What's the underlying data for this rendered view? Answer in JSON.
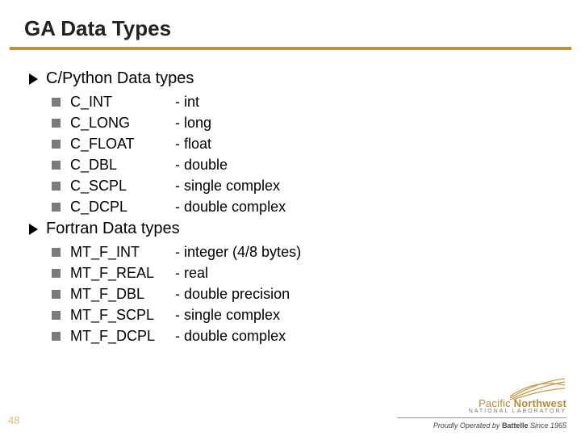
{
  "title": "GA Data Types",
  "pageNumber": "48",
  "sections": [
    {
      "heading": "C/Python Data types",
      "items": [
        {
          "name": "C_INT",
          "desc": "- int"
        },
        {
          "name": "C_LONG",
          "desc": "- long"
        },
        {
          "name": "C_FLOAT",
          "desc": "- float"
        },
        {
          "name": "C_DBL",
          "desc": "- double"
        },
        {
          "name": "C_SCPL",
          "desc": "- single complex"
        },
        {
          "name": "C_DCPL",
          "desc": "- double complex"
        }
      ]
    },
    {
      "heading": "Fortran Data types",
      "items": [
        {
          "name": "MT_F_INT",
          "desc": "- integer (4/8 bytes)"
        },
        {
          "name": "MT_F_REAL",
          "desc": "- real"
        },
        {
          "name": "MT_F_DBL",
          "desc": "- double precision"
        },
        {
          "name": "MT_F_SCPL",
          "desc": "- single complex"
        },
        {
          "name": "MT_F_DCPL",
          "desc": "- double complex"
        }
      ]
    }
  ],
  "footer": {
    "labText1a": "Pacific ",
    "labText1b": "Northwest",
    "labText2": "NATIONAL LABORATORY",
    "operatedPrefix": "Proudly Operated by ",
    "operatedBrand": "Battelle",
    "operatedSince": " Since 1965"
  }
}
